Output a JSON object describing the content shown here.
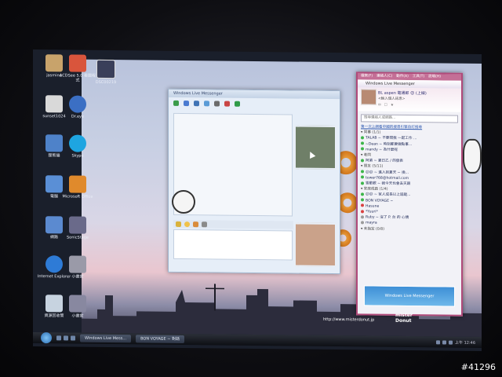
{
  "desktop": {
    "icons": [
      {
        "label": "jasmine",
        "color": "#c8a36b"
      },
      {
        "label": "ACDSee 5.0 看圖程式",
        "color": "#d9553c"
      },
      {
        "label": "DSC00219",
        "color": "#3a3f5a"
      },
      {
        "label": "sunset1024",
        "color": "#d9d9d9"
      },
      {
        "label": "Dr.eye",
        "color": "#3b6fc4"
      },
      {
        "label": "狸熊貓",
        "color": "#4e82c9"
      },
      {
        "label": "Skype",
        "color": "#1ea5e1"
      },
      {
        "label": "電腦",
        "color": "#5a8fd6"
      },
      {
        "label": "Microsoft Office",
        "color": "#e08a2c"
      },
      {
        "label": "網路",
        "color": "#5b8ad0"
      },
      {
        "label": "SonicStage",
        "color": "#6a6a8a"
      },
      {
        "label": "Internet Explorer",
        "color": "#2e7bd6"
      },
      {
        "label": "小畫家",
        "color": "#9a9aa8"
      },
      {
        "label": "資源回收筒",
        "color": "#c7d3e0"
      },
      {
        "label": "小畫家",
        "color": "#8888a0"
      }
    ]
  },
  "chat_window": {
    "title": "Windows Live Messenger"
  },
  "contact_list": {
    "menu": [
      "檔案(F)",
      "連絡人(C)",
      "動作(A)",
      "工具(T)",
      "說明(H)"
    ],
    "title": "Windows Live Messenger",
    "profile_name": "BL aspen 電通郎 😊 (上線)",
    "profile_message": "<輸入個人訊息>",
    "search_placeholder": "搜尋連絡人或網路...",
    "rows": [
      {
        "text": "第一次上網看中國的搜尋引擎自訂搜尋",
        "type": "link"
      },
      {
        "text": "▾ 同事 (1/1)",
        "type": "group"
      },
      {
        "text": "TALAB ~ 不要問我 一起工作 ...",
        "type": "online"
      },
      {
        "text": "~Dean ~ 時刻都要做點事...",
        "type": "online"
      },
      {
        "text": "mandy ~ 為什麼呢",
        "type": "online"
      },
      {
        "text": "▾ 老同",
        "type": "group"
      },
      {
        "text": "阿弟 ~ 夏日乙 / 的發表",
        "type": "online"
      },
      {
        "text": "▾ 朋友 (5/11)",
        "type": "group"
      },
      {
        "text": "😊😊 ~ 進入到夏天 ~ 換...",
        "type": "online"
      },
      {
        "text": "tower768@hotmail.com",
        "type": "online"
      },
      {
        "text": "雪歡歡 ~ 我今天也會去天跟",
        "type": "online"
      },
      {
        "text": "▾ 家庭成員 (1/4)",
        "type": "group"
      },
      {
        "text": "😊😊 ~ 家人成長以上追蹤...",
        "type": "online"
      },
      {
        "text": "BON VOYAGE ~",
        "type": "online"
      },
      {
        "text": "Hasune",
        "type": "busy"
      },
      {
        "text": "*Yuuri*",
        "type": "busy"
      },
      {
        "text": "Ruby ~ 沒了 P. 台 的 心情",
        "type": "offline"
      },
      {
        "text": "mayra",
        "type": "offline"
      },
      {
        "text": "▾ 未指定 (0/8)",
        "type": "group"
      }
    ],
    "banner": "Windows Live Messenger"
  },
  "taskbar": {
    "tasks": [
      "Windows Live Mess...",
      "BON VOYAGE ~ 對話"
    ],
    "clock": "上午 12:46"
  },
  "wallpaper": {
    "url": "http://www.misterdonut.jp",
    "brand_line1": "mister",
    "brand_line2": "Donut"
  },
  "watermark": "#41296"
}
